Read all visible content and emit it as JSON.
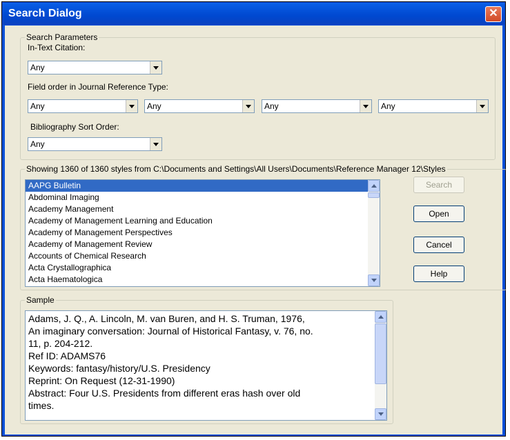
{
  "window": {
    "title": "Search Dialog",
    "close_label": "✕"
  },
  "search_parameters": {
    "legend": "Search Parameters",
    "in_text_citation": {
      "label": "In-Text Citation:",
      "value": "Any"
    },
    "field_order": {
      "label": "Field order in Journal Reference Type:",
      "values": [
        "Any",
        "Any",
        "Any",
        "Any"
      ]
    },
    "bibliography_sort": {
      "label": "Bibliography Sort Order:",
      "value": "Any"
    }
  },
  "styles": {
    "legend": "Showing 1360 of 1360 styles from C:\\Documents and Settings\\All Users\\Documents\\Reference Manager 12\\Styles",
    "items": [
      "AAPG Bulletin",
      "Abdominal Imaging",
      "Academy Management",
      "Academy of Management Learning and Education",
      "Academy of Management Perspectives",
      "Academy of Management Review",
      "Accounts of Chemical Research",
      "Acta Crystallographica",
      "Acta Haematologica"
    ],
    "selected_index": 0
  },
  "buttons": {
    "search": "Search",
    "open": "Open",
    "cancel": "Cancel",
    "help": "Help"
  },
  "sample": {
    "legend": "Sample",
    "lines": [
      "Adams, J. Q., A. Lincoln, M. van Buren, and H. S. Truman, 1976,",
      "An imaginary conversation: Journal of Historical Fantasy, v. 76, no.",
      "11, p. 204-212.",
      "Ref ID: ADAMS76",
      "Keywords: fantasy/history/U.S. Presidency",
      "Reprint: On Request (12-31-1990)",
      "Abstract: Four U.S. Presidents from different eras hash over old",
      "times."
    ]
  }
}
